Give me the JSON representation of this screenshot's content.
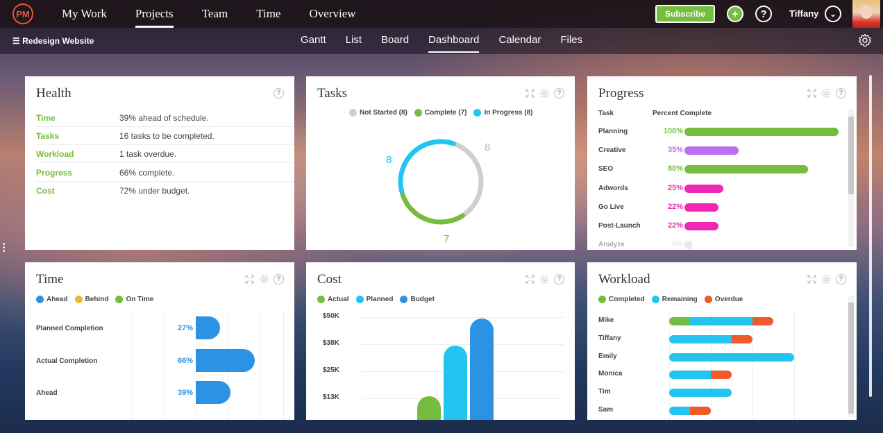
{
  "nav": {
    "logo": "PM",
    "items": [
      {
        "label": "My Work"
      },
      {
        "label": "Projects"
      },
      {
        "label": "Team"
      },
      {
        "label": "Time"
      },
      {
        "label": "Overview"
      }
    ],
    "active_index": 1,
    "subscribe_label": "Subscribe",
    "add_icon": "+",
    "help_icon": "?",
    "user_name": "Tiffany",
    "chevron_icon": "⌄"
  },
  "subnav": {
    "project_title": "Redesign Website",
    "tabs": [
      {
        "label": "Gantt"
      },
      {
        "label": "List"
      },
      {
        "label": "Board"
      },
      {
        "label": "Dashboard"
      },
      {
        "label": "Calendar"
      },
      {
        "label": "Files"
      }
    ],
    "active_index": 3
  },
  "colors": {
    "green": "#74bd3f",
    "cyan": "#22c5f0",
    "blue": "#2b92e4",
    "orange": "#ef5a2b",
    "purple": "#b86ff0",
    "pink": "#f026b4",
    "gray": "#cfcfcf",
    "yellow": "#e9b93c"
  },
  "health": {
    "title": "Health",
    "rows": [
      {
        "key": "Time",
        "value": "39% ahead of schedule."
      },
      {
        "key": "Tasks",
        "value": "16 tasks to be completed."
      },
      {
        "key": "Workload",
        "value": "1 task overdue."
      },
      {
        "key": "Progress",
        "value": "66% complete."
      },
      {
        "key": "Cost",
        "value": "72% under budget."
      }
    ]
  },
  "tasks": {
    "title": "Tasks",
    "legend": [
      "Not Started (8)",
      "Complete (7)",
      "In Progress (8)"
    ],
    "not_started": 8,
    "complete": 7,
    "in_progress": 8,
    "label_not_started": "8",
    "label_complete": "7",
    "label_in_progress": "8"
  },
  "progress": {
    "title": "Progress",
    "col_task": "Task",
    "col_pct": "Percent Complete",
    "rows": [
      {
        "task": "Planning",
        "pct_label": "100%",
        "value": 100,
        "color": "#74bd3f"
      },
      {
        "task": "Creative",
        "pct_label": "35%",
        "value": 35,
        "color": "#b86ff0"
      },
      {
        "task": "SEO",
        "pct_label": "80%",
        "value": 80,
        "color": "#74bd3f"
      },
      {
        "task": "Adwords",
        "pct_label": "25%",
        "value": 25,
        "color": "#f026b4"
      },
      {
        "task": "Go Live",
        "pct_label": "22%",
        "value": 22,
        "color": "#f026b4"
      },
      {
        "task": "Post-Launch",
        "pct_label": "22%",
        "value": 22,
        "color": "#f026b4"
      },
      {
        "task": "Analyze",
        "pct_label": "0%",
        "value": 0,
        "color": "#cfcfcf"
      }
    ]
  },
  "time": {
    "title": "Time",
    "legend": [
      "Ahead",
      "Behind",
      "On Time"
    ],
    "rows": [
      {
        "label": "Planned Completion",
        "pct_label": "27%",
        "value": 27
      },
      {
        "label": "Actual Completion",
        "pct_label": "66%",
        "value": 66
      },
      {
        "label": "Ahead",
        "pct_label": "39%",
        "value": 39
      }
    ]
  },
  "cost": {
    "title": "Cost",
    "legend": [
      "Actual",
      "Planned",
      "Budget"
    ],
    "y_ticks": [
      "$50K",
      "$38K",
      "$25K",
      "$13K"
    ],
    "chart_data": {
      "type": "bar",
      "categories": [
        "Actual",
        "Planned",
        "Budget"
      ],
      "values": [
        11000,
        35000,
        48000
      ],
      "ylim": [
        0,
        50000
      ]
    }
  },
  "workload": {
    "title": "Workload",
    "legend": [
      "Completed",
      "Remaining",
      "Overdue"
    ],
    "rows": [
      {
        "name": "Mike",
        "completed": 2,
        "remaining": 6,
        "overdue": 2
      },
      {
        "name": "Tiffany",
        "completed": 0,
        "remaining": 6,
        "overdue": 2
      },
      {
        "name": "Emily",
        "completed": 0,
        "remaining": 12,
        "overdue": 0
      },
      {
        "name": "Monica",
        "completed": 0,
        "remaining": 4,
        "overdue": 2
      },
      {
        "name": "Tim",
        "completed": 0,
        "remaining": 6,
        "overdue": 0
      },
      {
        "name": "Sam",
        "completed": 0,
        "remaining": 2,
        "overdue": 2
      }
    ]
  }
}
